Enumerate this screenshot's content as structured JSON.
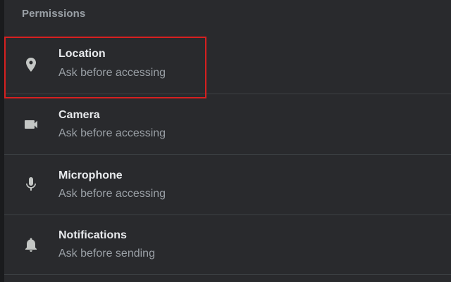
{
  "section": {
    "title": "Permissions"
  },
  "permissions": [
    {
      "label": "Location",
      "status": "Ask before accessing",
      "icon": "location-pin-icon"
    },
    {
      "label": "Camera",
      "status": "Ask before accessing",
      "icon": "video-camera-icon"
    },
    {
      "label": "Microphone",
      "status": "Ask before accessing",
      "icon": "microphone-icon"
    },
    {
      "label": "Notifications",
      "status": "Ask before sending",
      "icon": "bell-icon"
    }
  ],
  "colors": {
    "background": "#292a2d",
    "primary_text": "#e8eaed",
    "secondary_text": "#9aa0a6",
    "highlight": "#d62020"
  }
}
